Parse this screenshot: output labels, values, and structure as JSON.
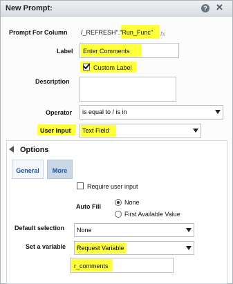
{
  "dialog": {
    "title": "New Prompt:",
    "help_glyph": "?",
    "close_glyph": "✕"
  },
  "form": {
    "prompt_for_column_label": "Prompt For Column",
    "prompt_for_column_value": "/_REFRESH\".\"Run_Func\"",
    "fx_glyph": "fx",
    "label_label": "Label",
    "label_value": "Enter Comments",
    "custom_label_text": "Custom Label",
    "custom_label_checked": true,
    "description_label": "Description",
    "description_value": "",
    "operator_label": "Operator",
    "operator_value": "is equal to / is in",
    "user_input_label": "User Input",
    "user_input_value": "Text Field"
  },
  "options": {
    "header": "Options",
    "tabs": [
      {
        "label": "General"
      },
      {
        "label": "More"
      }
    ],
    "require_user_input": "Require user input",
    "require_user_input_checked": false,
    "auto_fill_label": "Auto Fill",
    "auto_fill_options": [
      {
        "label": "None",
        "selected": true
      },
      {
        "label": "First Available Value",
        "selected": false
      }
    ],
    "default_selection_label": "Default selection",
    "default_selection_value": "None",
    "set_variable_label": "Set a variable",
    "set_variable_value": "Request Variable",
    "variable_name": "r_comments"
  },
  "colors": {
    "highlight": "#ffff3a",
    "tab_text": "#1d4f9a",
    "tab_selected_bg": "#c8d6e5"
  }
}
